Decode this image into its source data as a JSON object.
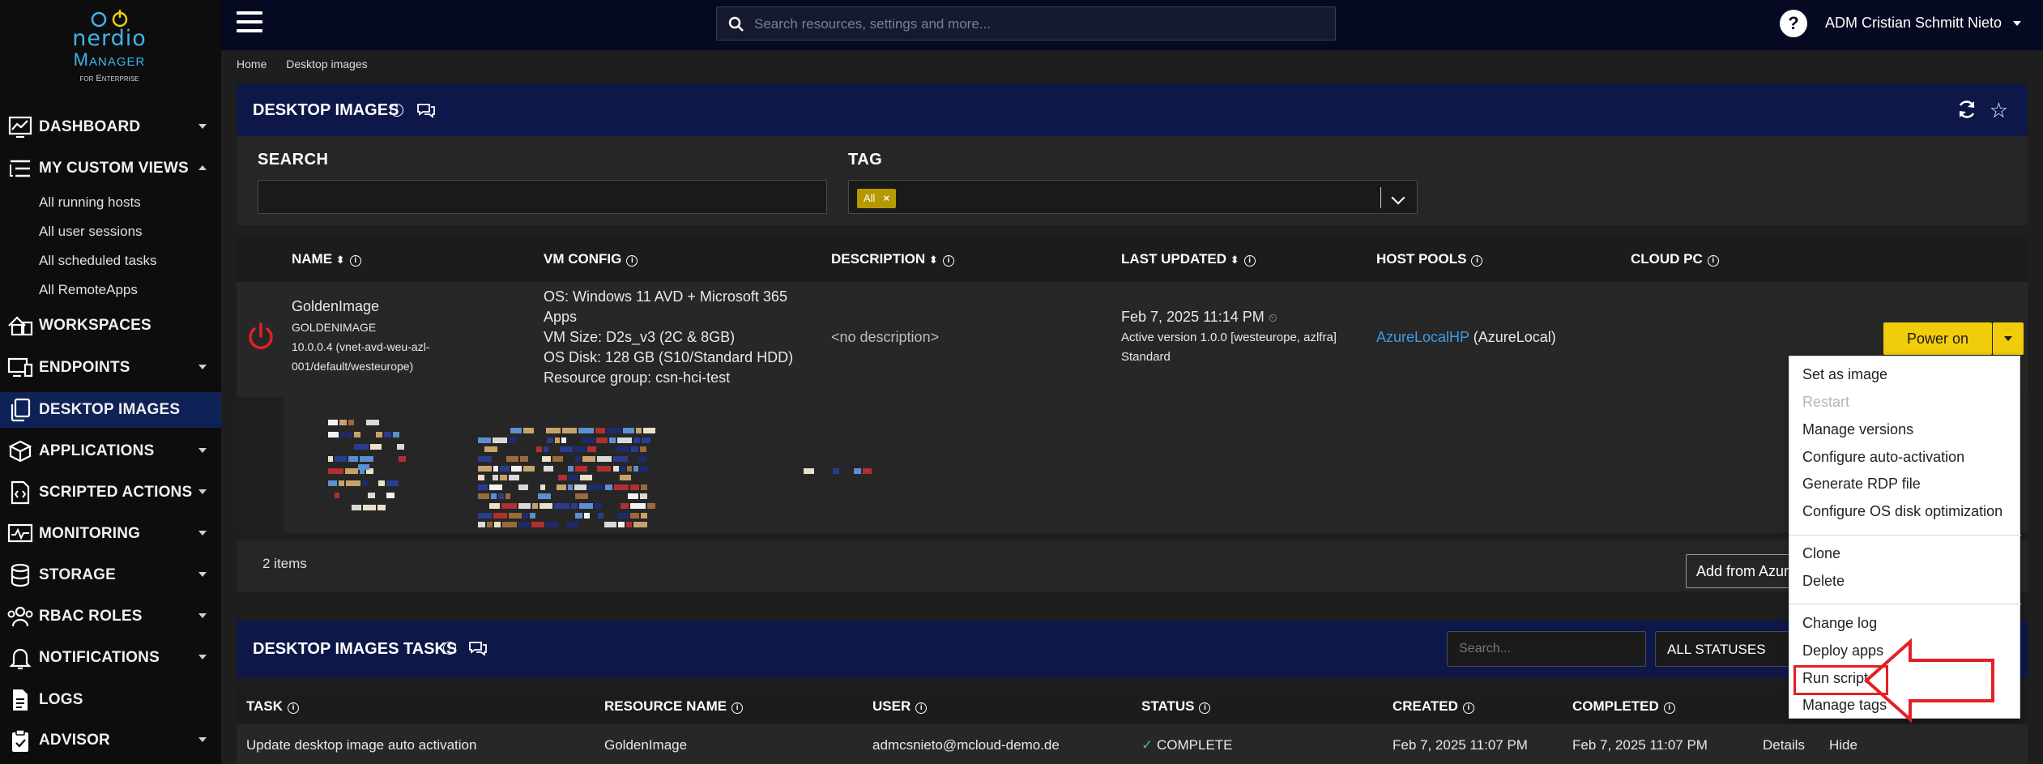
{
  "logo": {
    "line1": "nerdio",
    "line2": "Manager",
    "line3": "for Enterprise"
  },
  "sidebar": {
    "items": [
      {
        "label": "DASHBOARD",
        "icon": "dashboard-icon"
      },
      {
        "label": "MY CUSTOM VIEWS",
        "icon": "custom-views-icon"
      },
      {
        "label": "WORKSPACES",
        "icon": "workspaces-icon"
      },
      {
        "label": "ENDPOINTS",
        "icon": "endpoints-icon"
      },
      {
        "label": "DESKTOP IMAGES",
        "icon": "desktop-images-icon",
        "active": true
      },
      {
        "label": "APPLICATIONS",
        "icon": "applications-icon"
      },
      {
        "label": "SCRIPTED ACTIONS",
        "icon": "scripted-actions-icon"
      },
      {
        "label": "MONITORING",
        "icon": "monitoring-icon"
      },
      {
        "label": "STORAGE",
        "icon": "storage-icon"
      },
      {
        "label": "RBAC ROLES",
        "icon": "rbac-roles-icon"
      },
      {
        "label": "NOTIFICATIONS",
        "icon": "notifications-icon"
      },
      {
        "label": "LOGS",
        "icon": "logs-icon"
      },
      {
        "label": "ADVISOR",
        "icon": "advisor-icon"
      }
    ],
    "custom_views": [
      "All running hosts",
      "All user sessions",
      "All scheduled tasks",
      "All RemoteApps"
    ]
  },
  "topbar": {
    "search_placeholder": "Search resources, settings and more...",
    "user": "ADM Cristian Schmitt Nieto"
  },
  "breadcrumb": [
    "Home",
    "Desktop images"
  ],
  "panel": {
    "title": "DESKTOP IMAGES",
    "search_label": "SEARCH",
    "tag_label": "TAG",
    "tag_chip": "All"
  },
  "table": {
    "headers": [
      "NAME",
      "VM CONFIG",
      "DESCRIPTION",
      "LAST UPDATED",
      "HOST POOLS",
      "CLOUD PC"
    ],
    "row": {
      "name": "GoldenImage",
      "name_upper": "GOLDENIMAGE",
      "network_1": "10.0.0.4 (vnet-avd-weu-azl-",
      "network_2": "001/default/westeurope)",
      "os_1": "OS: Windows 11 AVD + Microsoft 365",
      "os_2": "Apps",
      "vm_size": "VM Size: D2s_v3 (2C & 8GB)",
      "os_disk": "OS Disk: 128 GB (S10/Standard HDD)",
      "resource_group": "Resource group: csn-hci-test",
      "description": "<no description>",
      "updated": "Feb 7, 2025 11:14 PM",
      "active_version": "Active version 1.0.0 [westeurope, azlfra]",
      "tier": "Standard",
      "host_pool_link": "AzureLocalHP",
      "host_pool_suffix": " (AzureLocal)",
      "power_button": "Power on"
    },
    "count": "2 items",
    "add_button": "Add from Azure"
  },
  "tasks": {
    "title": "DESKTOP IMAGES TASKS",
    "search_placeholder": "Search...",
    "status_filter": "ALL STATUSES",
    "headers": [
      "TASK",
      "RESOURCE NAME",
      "USER",
      "STATUS",
      "CREATED",
      "COMPLETED"
    ],
    "row": {
      "task": "Update desktop image auto activation",
      "resource": "GoldenImage",
      "user": "admcsnieto@mcloud-demo.de",
      "status": "COMPLETE",
      "created": "Feb 7, 2025 11:07 PM",
      "completed": "Feb 7, 2025 11:07 PM",
      "details": "Details",
      "hide": "Hide"
    }
  },
  "menu": {
    "items": [
      {
        "label": "Set as image",
        "disabled": false
      },
      {
        "label": "Restart",
        "disabled": true
      },
      {
        "label": "Manage versions",
        "disabled": false
      },
      {
        "label": "Configure auto-activation",
        "disabled": false
      },
      {
        "label": "Generate RDP file",
        "disabled": false
      },
      {
        "label": "Configure OS disk optimization",
        "disabled": false
      },
      {
        "label": "Clone",
        "disabled": false
      },
      {
        "label": "Delete",
        "disabled": false
      },
      {
        "label": "Change log",
        "disabled": false
      },
      {
        "label": "Deploy apps",
        "disabled": false
      },
      {
        "label": "Run script",
        "disabled": false,
        "highlighted": true
      },
      {
        "label": "Manage tags",
        "disabled": false
      }
    ]
  },
  "colors": {
    "accent_yellow": "#f0cc0a",
    "header_navy": "#0d1748",
    "link_blue": "#3d9be9",
    "highlight_red": "#e32024",
    "power_red": "#e32024"
  }
}
